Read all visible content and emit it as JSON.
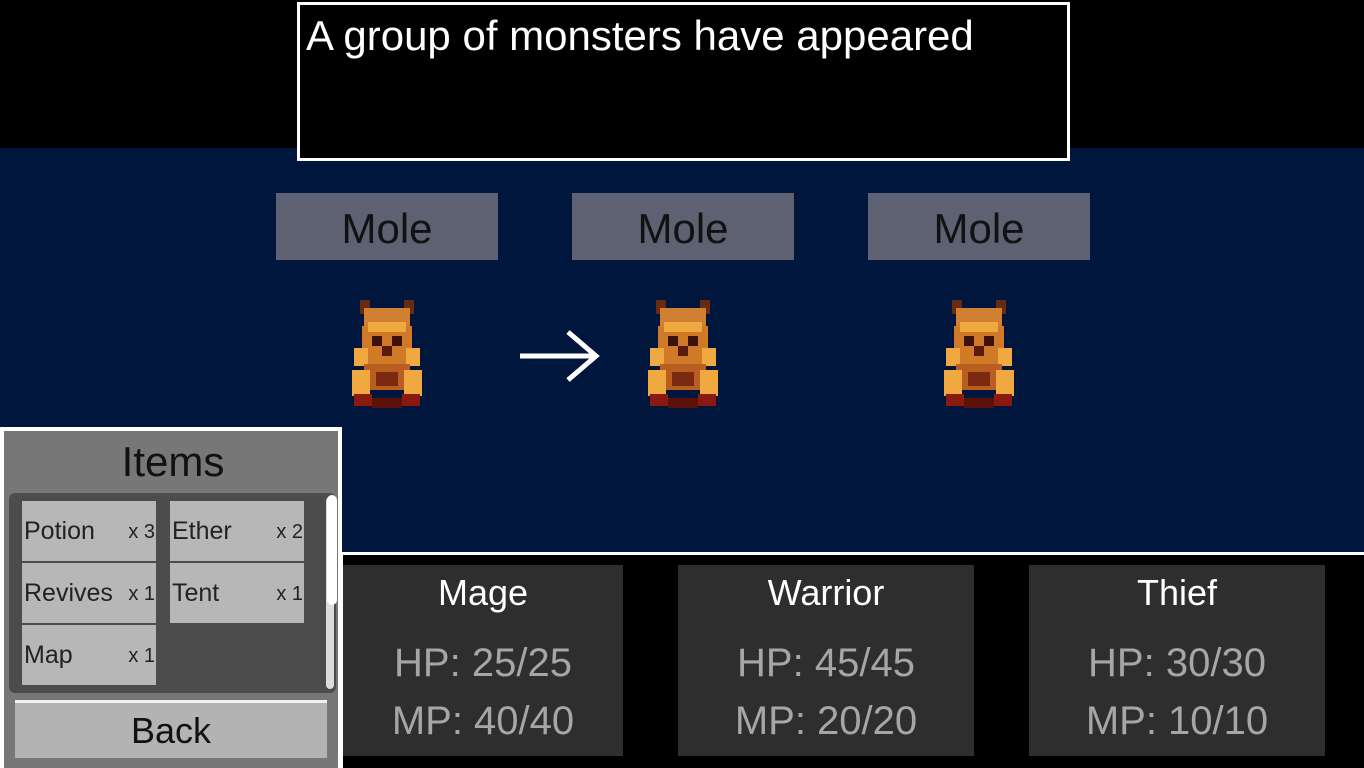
{
  "message": "A group of monsters have appeared",
  "enemies": [
    {
      "name": "Mole"
    },
    {
      "name": "Mole"
    },
    {
      "name": "Mole"
    }
  ],
  "items_menu": {
    "title": "Items",
    "items": [
      {
        "name": "Potion",
        "count": "x 3"
      },
      {
        "name": "Ether",
        "count": "x 2"
      },
      {
        "name": "Revives",
        "count": "x 1"
      },
      {
        "name": "Tent",
        "count": "x 1"
      },
      {
        "name": "Map",
        "count": "x 1"
      }
    ],
    "back_label": "Back"
  },
  "party": [
    {
      "name": "Mage",
      "hp": "HP: 25/25",
      "mp": "MP: 40/40"
    },
    {
      "name": "Warrior",
      "hp": "HP: 45/45",
      "mp": "MP: 20/20"
    },
    {
      "name": "Thief",
      "hp": "HP: 30/30",
      "mp": "MP: 10/10"
    }
  ],
  "colors": {
    "battlefield": "#00163c",
    "enemy_label_bg": "#5e6172",
    "party_card_bg": "#2e2e2e",
    "item_slot_bg": "#b7b7b7"
  },
  "icons": [
    "mole-sprite-icon",
    "target-arrow-icon"
  ]
}
